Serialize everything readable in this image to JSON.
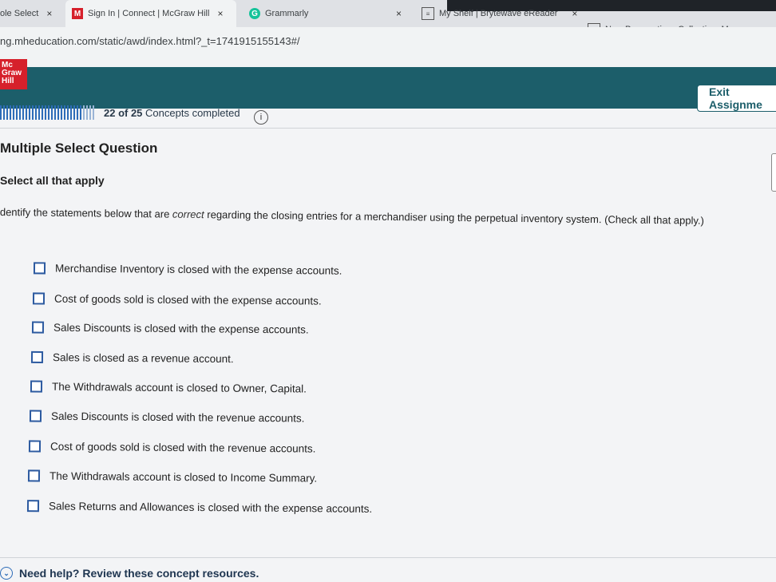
{
  "browser": {
    "tabs": [
      {
        "label": "ole Select",
        "close": "×"
      },
      {
        "label": "Sign In | Connect | McGraw Hill",
        "logo": "M",
        "close": "×"
      },
      {
        "label": "Grammarly",
        "logo": "G"
      },
      {
        "label": "",
        "close": "×"
      },
      {
        "label": "My Shelf | Brytewave eReader",
        "close": "×"
      },
      {
        "label": "New Perspectives Collection, M",
        "close": "×"
      }
    ],
    "new_tab": "+",
    "url": "ng.mheducation.com/static/awd/index.html?_t=1741915155143#/"
  },
  "header": {
    "logo_lines": [
      "Mc",
      "Graw",
      "Hill"
    ],
    "exit_label": "Exit Assignme"
  },
  "progress": {
    "completed": "22 of 25",
    "suffix": "Concepts completed",
    "fraction": 0.88,
    "info_icon": "i"
  },
  "question": {
    "title": "Multiple Select Question",
    "instruction": "Select all that apply",
    "prompt_pre": "dentify the statements below that are ",
    "prompt_em": "correct",
    "prompt_post": " regarding the closing entries for a merchandiser using the perpetual inventory system. (Check all that apply.)",
    "options": [
      "Merchandise Inventory is closed with the expense accounts.",
      "Cost of goods sold is closed with the expense accounts.",
      "Sales Discounts is closed with the expense accounts.",
      "Sales is closed as a revenue account.",
      "The Withdrawals account is closed to Owner, Capital.",
      "Sales Discounts is closed with the revenue accounts.",
      "Cost of goods sold is closed with the revenue accounts.",
      "The Withdrawals account is closed to Income Summary.",
      "Sales Returns and Allowances is closed with the expense accounts."
    ]
  },
  "help": {
    "label": "Need help? Review these concept resources."
  }
}
